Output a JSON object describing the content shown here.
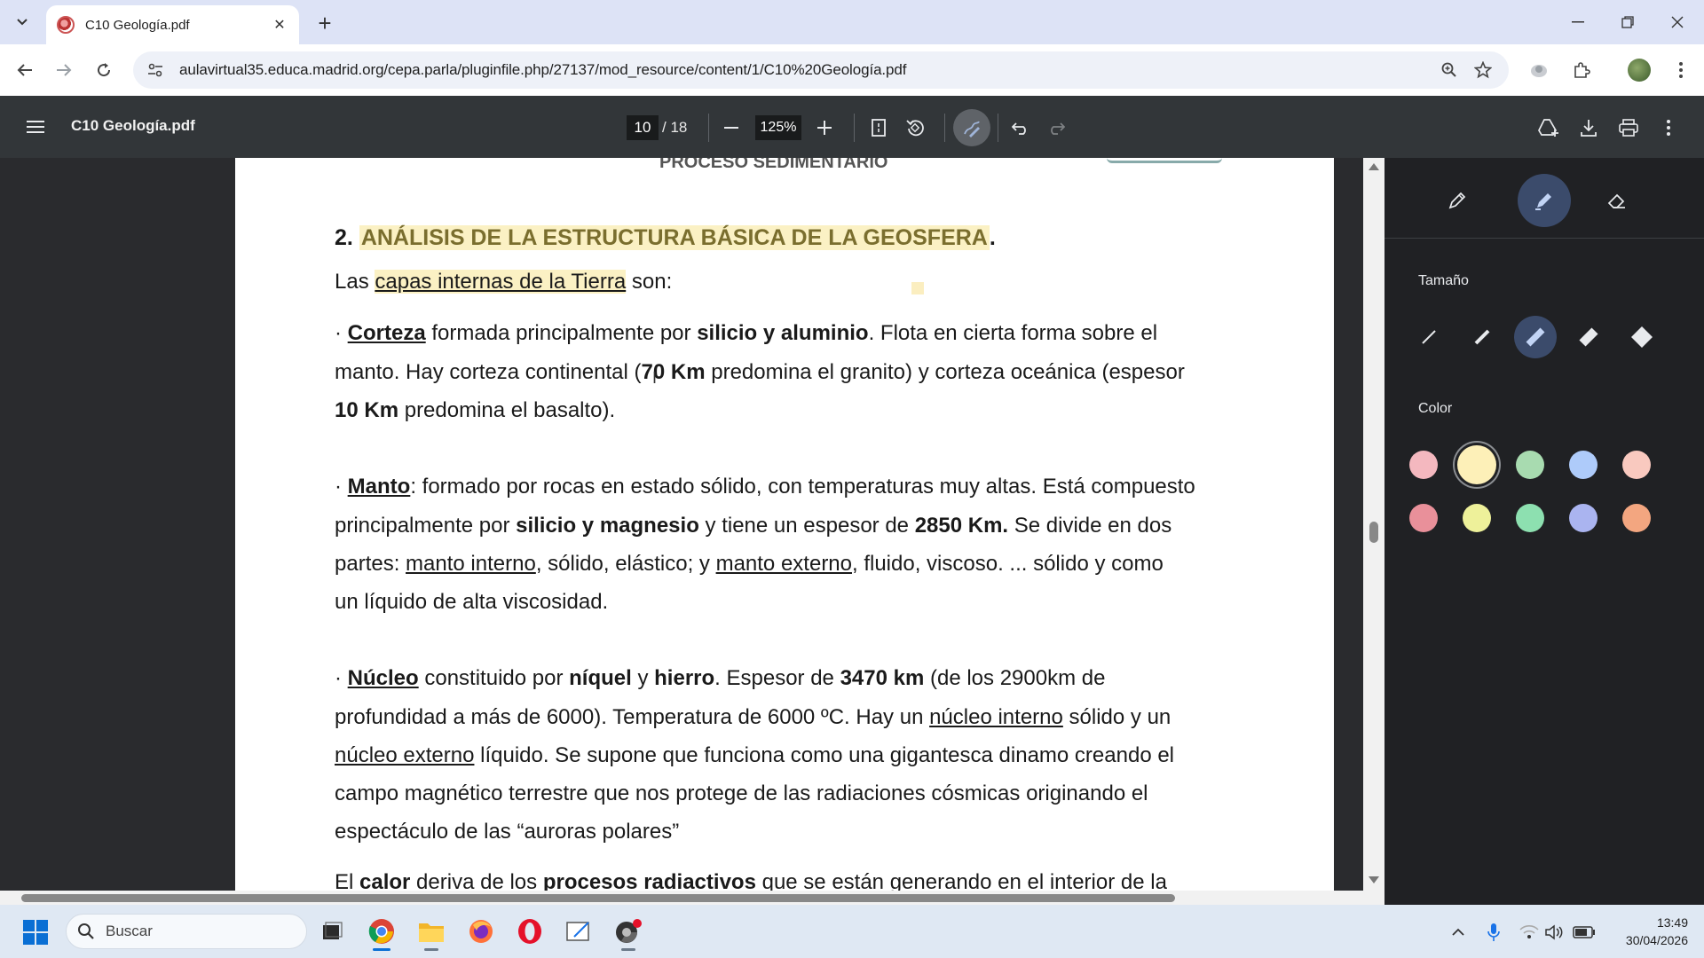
{
  "browser": {
    "tab_title": "C10 Geología.pdf",
    "url": "aulavirtual35.educa.madrid.org/cepa.parla/pluginfile.php/27137/mod_resource/content/1/C10%20Geología.pdf"
  },
  "pdf_toolbar": {
    "file_name": "C10 Geología.pdf",
    "current_page": "10",
    "total_pages": "/ 18",
    "zoom": "125%"
  },
  "document": {
    "cut_heading": "PROCESO SEDIMENTARIO",
    "heading_number": "2.",
    "heading_text": "ANÁLISIS  DE LA ESTRUCTURA BÁSICA DE LA GEOSFERA",
    "heading_period": ".",
    "intro": {
      "pre": "Las ",
      "highlight": "capas internas de la Tierra",
      "post": " son:"
    },
    "corteza": {
      "l1": {
        "bullet": "· ",
        "term": "Corteza",
        "t1": " formada principalmente  por ",
        "b1": "silicio y aluminio",
        "t2": ". Flota en cierta forma sobre el"
      },
      "l2": {
        "t1": "manto. Hay corteza continental (",
        "b1": "70 Km",
        "t2": " predomina el granito) y corteza oceánica (espesor"
      },
      "l3": {
        "b1": "10 Km",
        "t1": " predomina el basalto)."
      }
    },
    "manto": {
      "l1": {
        "bullet": "· ",
        "term": "Manto",
        "t1": ": formado por rocas en estado sólido, con temperaturas muy altas. Está compuesto"
      },
      "l2": {
        "t1": "principalmente  por ",
        "b1": "silicio y magnesio",
        "t2": " y tiene un espesor de ",
        "b2": "2850 Km.",
        "t3": " Se divide en dos"
      },
      "l3": {
        "t1": "partes: ",
        "u1": "manto interno",
        "t2": ", sólido, elástico; y ",
        "u2": "manto externo",
        "t3": ", fluido, viscoso. ... sólido y como"
      },
      "l4": {
        "t1": "un líquido de alta viscosidad."
      }
    },
    "nucleo": {
      "l1": {
        "bullet": "· ",
        "term": "Núcleo",
        "t1": " constituido  por ",
        "b1": "níquel",
        "t2": " y ",
        "b2": "hierro",
        "t3": ". Espesor de ",
        "b3": "3470 km",
        "t4": " (de los 2900km de"
      },
      "l2": {
        "t1": "profundidad a más de 6000). Temperatura de 6000 ºC.  Hay un ",
        "u1": "núcleo interno",
        "t2": " sólido y un"
      },
      "l3": {
        "u1": "núcleo externo",
        "t1": " líquido. Se supone que funciona como una gigantesca dinamo creando el"
      },
      "l4": {
        "t1": "campo magnético terrestre que nos protege de las radiaciones cósmicas originando el"
      },
      "l5": {
        "t1": "espectáculo de las “auroras polares”"
      }
    },
    "calor_cut": {
      "t1": "El ",
      "b1": "calor",
      "t2": " deriva de los ",
      "b2": "procesos radiactivos",
      "t3": " que se están generando en el interior de la"
    }
  },
  "annotation_panel": {
    "size_label": "Tamaño",
    "color_label": "Color",
    "colors_row1": [
      "#f4b8bf",
      "#fdf0b8",
      "#a8dbb0",
      "#aecbfa",
      "#f9c9bf"
    ],
    "colors_row2": [
      "#e9909a",
      "#eef19a",
      "#8de0b0",
      "#aab4f0",
      "#f3a680"
    ],
    "selected_color": "#fdf0b8"
  },
  "taskbar": {
    "search_placeholder": "Buscar",
    "time": "13:49",
    "date": "30/04/2026"
  }
}
